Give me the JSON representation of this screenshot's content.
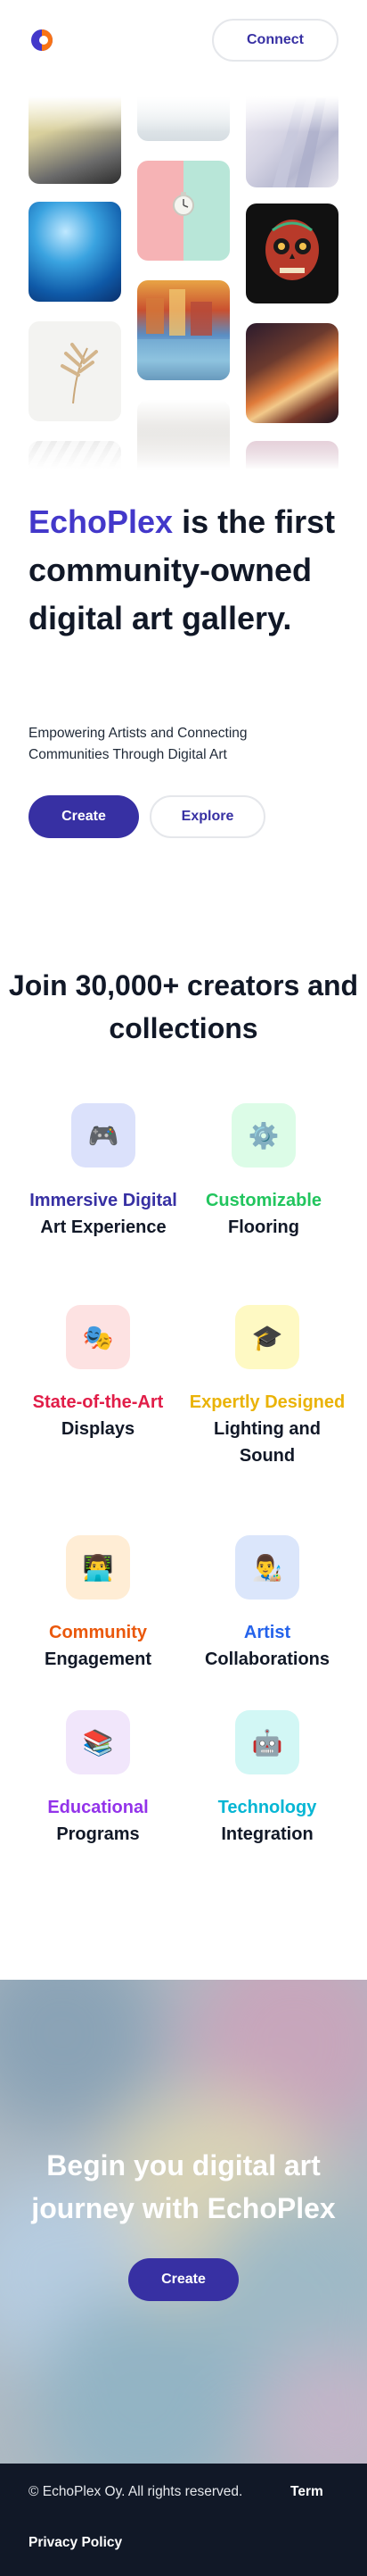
{
  "header": {
    "connect_label": "Connect"
  },
  "hero": {
    "brand": "EchoPlex",
    "title_rest": " is the first community-owned digital art gallery.",
    "subtitle": "Empowering Artists and Connecting Communities Through Digital Art",
    "create_label": "Create",
    "explore_label": "Explore"
  },
  "features": {
    "title": "Join 30,000+ creators and collections",
    "items": [
      {
        "highlight": "Immersive Digital",
        "rest": " Art Experience",
        "color": "#3730a3",
        "bg": "#dbeafe",
        "icon": "🎮"
      },
      {
        "highlight": "Customizable",
        "rest": " Flooring",
        "color": "#22c55e",
        "bg": "#dcfce7",
        "icon": "⚙️"
      },
      {
        "highlight": "State-of-the-Art",
        "rest": " Displays",
        "color": "#e11d48",
        "bg": "#fee2e2",
        "icon": "🎭"
      },
      {
        "highlight": "Expertly Designed",
        "rest": " Lighting and Sound",
        "color": "#eab308",
        "bg": "#fef9c3",
        "icon": "🎓"
      },
      {
        "highlight": "Community",
        "rest": " Engagement",
        "color": "#ea580c",
        "bg": "#ffedd5",
        "icon": "👨‍💻"
      },
      {
        "highlight": "Artist",
        "rest": " Collaborations",
        "color": "#2563eb",
        "bg": "#dbeafe",
        "icon": "👨‍🎨"
      },
      {
        "highlight": "Educational",
        "rest": " Programs",
        "color": "#9333ea",
        "bg": "#f3e8ff",
        "icon": "📚"
      },
      {
        "highlight": "Technology",
        "rest": " Integration",
        "color": "#06b6d4",
        "bg": "#cffafe",
        "icon": "🤖"
      }
    ]
  },
  "cta": {
    "title": "Begin you digital art journey with EchoPlex",
    "button_label": "Create"
  },
  "footer": {
    "copyright": "© EchoPlex Oy. All rights reserved.",
    "terms": "Term",
    "privacy": "Privacy Policy"
  }
}
